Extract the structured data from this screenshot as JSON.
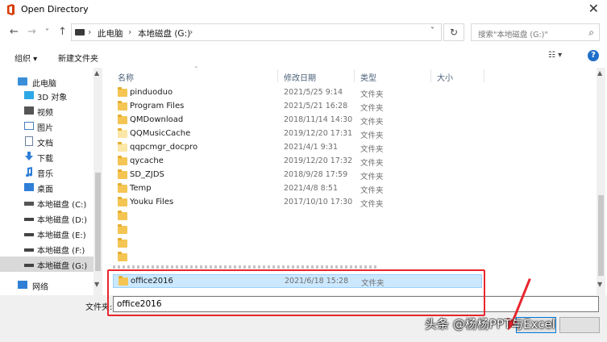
{
  "window": {
    "title": "Open Directory",
    "close_glyph": "✕",
    "app_icon": "office-icon"
  },
  "nav": {
    "back": "←",
    "forward": "→",
    "recent": "˅",
    "up": "↑"
  },
  "breadcrumb": {
    "items": [
      "此电脑",
      "本地磁盘 (G:)"
    ],
    "sep": "›",
    "dropdown": "˅"
  },
  "refresh_glyph": "↻",
  "search": {
    "placeholder": "搜索\"本地磁盘 (G:)\"",
    "icon": "⌕"
  },
  "toolbar": {
    "organize": "组织 ▾",
    "new_folder": "新建文件夹",
    "view": "☷ ▾",
    "help": "?"
  },
  "sidebar": {
    "items": [
      {
        "label": "此电脑",
        "icon": "computer-icon",
        "color": "#3b8fd9"
      },
      {
        "label": "3D 对象",
        "icon": "cube-icon",
        "color": "#2ea8e6"
      },
      {
        "label": "视频",
        "icon": "video-icon",
        "color": "#555555"
      },
      {
        "label": "图片",
        "icon": "picture-icon",
        "color": "#4a7fc0"
      },
      {
        "label": "文档",
        "icon": "document-icon",
        "color": "#6b7f99"
      },
      {
        "label": "下载",
        "icon": "download-icon",
        "color": "#2f7fd6"
      },
      {
        "label": "音乐",
        "icon": "music-icon",
        "color": "#2f7fd6"
      },
      {
        "label": "桌面",
        "icon": "desktop-icon",
        "color": "#2f7fd6"
      },
      {
        "label": "本地磁盘 (C:)",
        "icon": "windows-drive-icon",
        "color": "#555555"
      },
      {
        "label": "本地磁盘 (D:)",
        "icon": "drive-icon",
        "color": "#444444"
      },
      {
        "label": "本地磁盘 (E:)",
        "icon": "drive-icon",
        "color": "#444444"
      },
      {
        "label": "本地磁盘 (F:)",
        "icon": "drive-icon",
        "color": "#444444"
      },
      {
        "label": "本地磁盘 (G:)",
        "icon": "drive-icon",
        "color": "#444444"
      },
      {
        "label": "网络",
        "icon": "network-icon",
        "color": "#2f7fd6"
      }
    ],
    "selected_index": 12
  },
  "columns": {
    "name": "名称",
    "date": "修改日期",
    "type": "类型",
    "size": "大小"
  },
  "files": [
    {
      "name": "pinduoduo",
      "date": "2021/5/25 9:14",
      "type": "文件夹"
    },
    {
      "name": "Program Files",
      "date": "2021/5/21 16:28",
      "type": "文件夹"
    },
    {
      "name": "QMDownload",
      "date": "2018/11/14 14:30",
      "type": "文件夹"
    },
    {
      "name": "QQMusicCache",
      "date": "2019/12/20 17:31",
      "type": "文件夹"
    },
    {
      "name": "qqpcmgr_docpro",
      "date": "2021/4/1 9:31",
      "type": "文件夹"
    },
    {
      "name": "qycache",
      "date": "2019/12/20 17:32",
      "type": "文件夹"
    },
    {
      "name": "SD_ZJDS",
      "date": "2018/9/28 17:59",
      "type": "文件夹"
    },
    {
      "name": "Temp",
      "date": "2021/4/8 8:51",
      "type": "文件夹"
    },
    {
      "name": "Youku Files",
      "date": "2017/10/10 17:30",
      "type": "文件夹"
    }
  ],
  "selected_file": {
    "name": "office2016",
    "date": "2021/6/18 15:28",
    "type": "文件夹"
  },
  "footer": {
    "folder_label": "文件夹:",
    "folder_value": "office2016"
  },
  "watermark": "头条 @杨杨PPT与Excel",
  "colors": {
    "accent": "#0078d7",
    "selection": "#cce8ff",
    "annotation": "#e8262d",
    "folder": "#f4c553"
  }
}
